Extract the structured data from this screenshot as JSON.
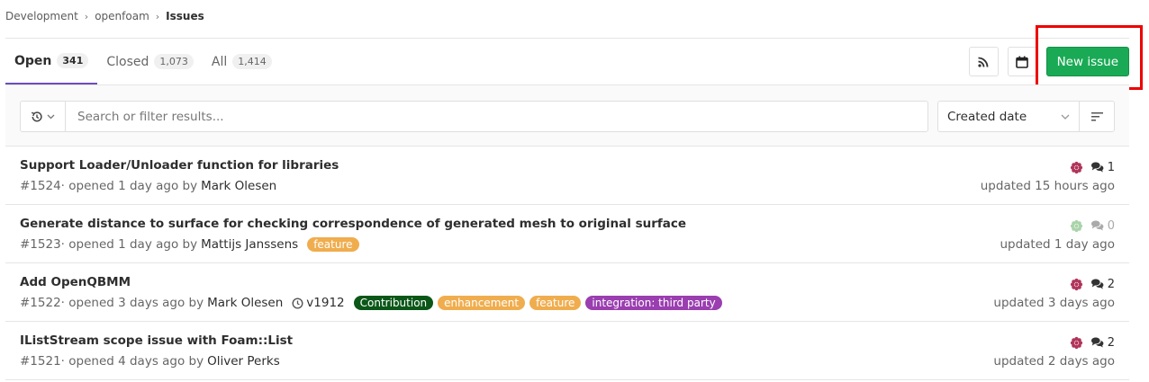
{
  "breadcrumb": {
    "group": "Development",
    "project": "openfoam",
    "current": "Issues"
  },
  "tabs": [
    {
      "label": "Open",
      "count": "341"
    },
    {
      "label": "Closed",
      "count": "1,073"
    },
    {
      "label": "All",
      "count": "1,414"
    }
  ],
  "actions": {
    "rss_icon": "rss-icon",
    "calendar_icon": "calendar-icon",
    "new_issue_label": "New issue",
    "new_issue_color": "#1aaa55",
    "highlight_color": "#ee0000"
  },
  "filter": {
    "placeholder": "Search or filter results...",
    "sort_label": "Created date"
  },
  "issues": [
    {
      "title": "Support Loader/Unloader function for libraries",
      "ref": "#1524",
      "opened": " · opened 1 day ago by",
      "author": "Mark Olesen",
      "comments": "1",
      "updated": "updated 15 hours ago"
    },
    {
      "title": "Generate distance to surface for checking correspondence of generated mesh to original surface",
      "ref": "#1523",
      "opened": " · opened 1 day ago by",
      "author": "Mattijs Janssens",
      "labels": [
        {
          "text": "feature",
          "color": "#f0ad4e"
        }
      ],
      "comments": "0",
      "updated": "updated 1 day ago"
    },
    {
      "title": "Add OpenQBMM",
      "ref": "#1522",
      "opened": " · opened 3 days ago by",
      "author": "Mark Olesen",
      "milestone": "v1912",
      "labels": [
        {
          "text": "Contribution",
          "color": "#0b5718"
        },
        {
          "text": "enhancement",
          "color": "#f0ad4e"
        },
        {
          "text": "feature",
          "color": "#f0ad4e"
        },
        {
          "text": "integration: third party",
          "color": "#9a3eb0"
        }
      ],
      "comments": "2",
      "updated": "updated 3 days ago"
    },
    {
      "title": "IListStream scope issue with Foam::List",
      "ref": "#1521",
      "opened": " · opened 4 days ago by",
      "author": "Oliver Perks",
      "comments": "2",
      "updated": "updated 2 days ago"
    }
  ]
}
